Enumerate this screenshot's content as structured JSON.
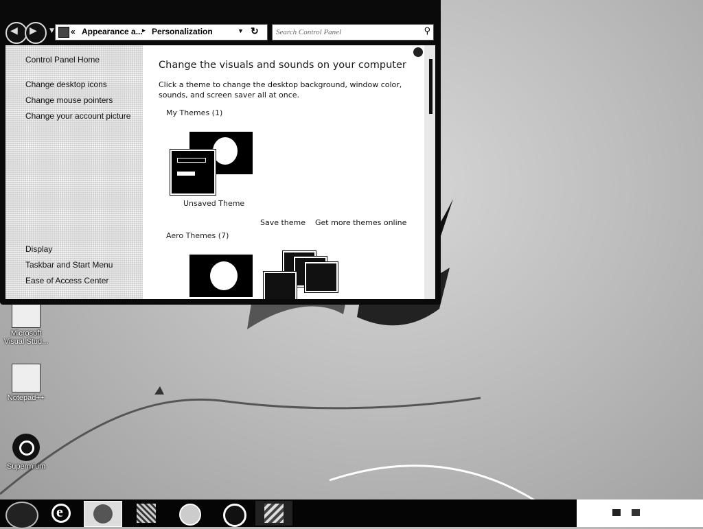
{
  "window": {
    "address": {
      "separator_back": "«",
      "crumb1": "Appearance a...",
      "separator": "▸",
      "crumb2": "Personalization"
    },
    "search": {
      "placeholder": "Search Control Panel"
    },
    "left_pane": {
      "home": "Control Panel Home",
      "tasks": [
        "Change desktop icons",
        "Change mouse pointers",
        "Change your account picture"
      ],
      "see_also": [
        "Display",
        "Taskbar and Start Menu",
        "Ease of Access Center"
      ]
    },
    "content": {
      "title": "Change the visuals and sounds on your computer",
      "description": "Click a theme to change the desktop background, window color, sounds, and screen saver all at once.",
      "my_themes_header": "My Themes (1)",
      "unsaved_theme_label": "Unsaved Theme",
      "save_theme_link": "Save theme",
      "get_more_link": "Get more themes online",
      "aero_themes_header": "Aero Themes (7)"
    }
  },
  "desktop_icons": [
    {
      "label": "Microsoft Visual Stud...",
      "icon": "visual-studio-icon"
    },
    {
      "label": "Notepad++",
      "icon": "notepad-plus-plus-icon"
    },
    {
      "label": "Supermium",
      "icon": "supermium-icon"
    }
  ],
  "taskbar": {
    "buttons": [
      "start-orb-icon",
      "internet-explorer-icon",
      "personalization-icon",
      "app-icon",
      "app-icon",
      "supermium-icon",
      "app-icon"
    ]
  }
}
